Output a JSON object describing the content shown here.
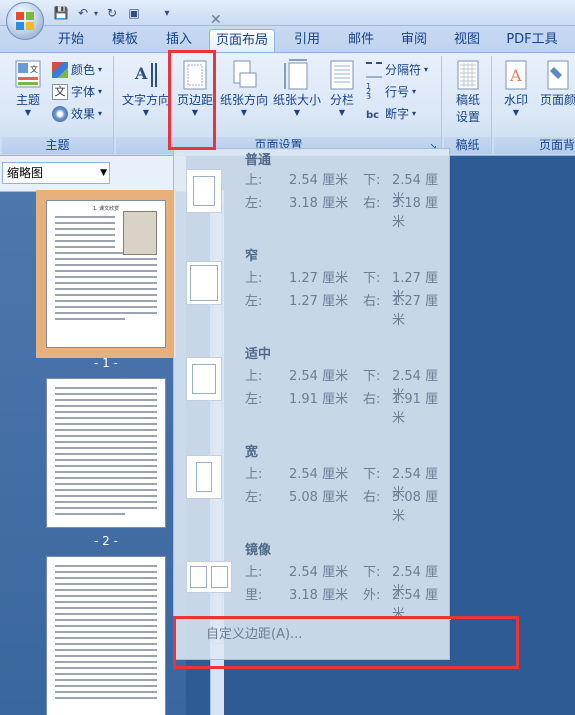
{
  "quick_access": {
    "save": "💾",
    "undo": "↶",
    "undo_dd": "▾",
    "redo": "↻",
    "page": "▣",
    "more": "▾"
  },
  "tabs": [
    "开始",
    "模板",
    "插入",
    "页面布局",
    "引用",
    "邮件",
    "审阅",
    "视图",
    "PDF工具"
  ],
  "active_tab": "页面布局",
  "ribbon": {
    "theme_group": {
      "label": "主题",
      "theme_button": "主题",
      "colors": "颜色",
      "fonts": "字体",
      "effects": "效果"
    },
    "page_setup_group": {
      "label": "页面设置",
      "text_direction": "文字方向",
      "margins": "页边距",
      "orientation": "纸张方向",
      "size": "纸张大小",
      "columns": "分栏",
      "breaks": "分隔符",
      "line_numbers": "行号",
      "hyphenation": "断字"
    },
    "draft_group": {
      "label": "稿纸",
      "draft_setup_line1": "稿纸",
      "draft_setup_line2": "设置"
    },
    "background_group": {
      "label": "页面背",
      "watermark": "水印",
      "page_color": "页面颜"
    }
  },
  "thumbnail_pane": {
    "view_select": "缩略图",
    "close": "✕",
    "pages": [
      "- 1 -",
      "- 2 -"
    ],
    "page1_title": "1. 课文欣赏"
  },
  "margins_menu": {
    "items": [
      {
        "name": "普通",
        "top_label": "上:",
        "top": "2.54 厘米",
        "bottom_label": "下:",
        "bottom": "2.54 厘米",
        "left_label": "左:",
        "left": "3.18 厘米",
        "right_label": "右:",
        "right": "3.18 厘米"
      },
      {
        "name": "窄",
        "top_label": "上:",
        "top": "1.27 厘米",
        "bottom_label": "下:",
        "bottom": "1.27 厘米",
        "left_label": "左:",
        "left": "1.27 厘米",
        "right_label": "右:",
        "right": "1.27 厘米"
      },
      {
        "name": "适中",
        "top_label": "上:",
        "top": "2.54 厘米",
        "bottom_label": "下:",
        "bottom": "2.54 厘米",
        "left_label": "左:",
        "left": "1.91 厘米",
        "right_label": "右:",
        "right": "1.91 厘米"
      },
      {
        "name": "宽",
        "top_label": "上:",
        "top": "2.54 厘米",
        "bottom_label": "下:",
        "bottom": "2.54 厘米",
        "left_label": "左:",
        "left": "5.08 厘米",
        "right_label": "右:",
        "right": "5.08 厘米"
      },
      {
        "name": "镜像",
        "top_label": "上:",
        "top": "2.54 厘米",
        "bottom_label": "下:",
        "bottom": "2.54 厘米",
        "left_label": "里:",
        "left": "3.18 厘米",
        "right_label": "外:",
        "right": "2.54 厘米"
      }
    ],
    "custom": "自定义边距(A)..."
  },
  "colors": {
    "highlight_red": "#e8353a",
    "selected_page": "#e8b07a"
  }
}
